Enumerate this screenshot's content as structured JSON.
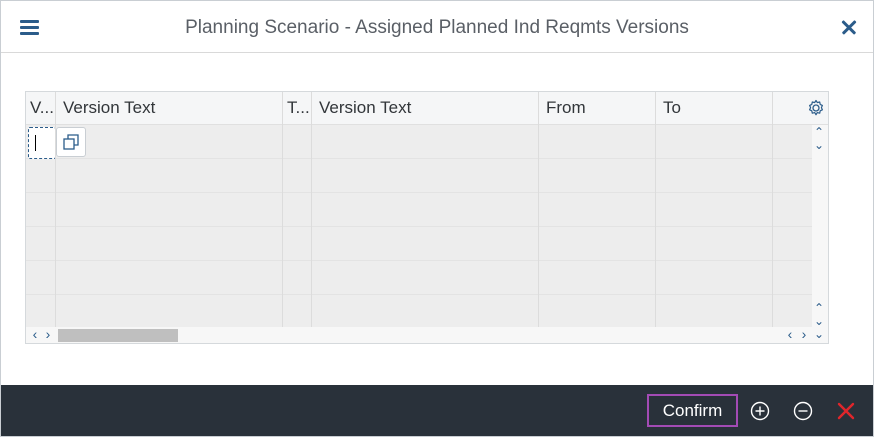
{
  "dialog": {
    "title": "Planning Scenario - Assigned Planned Ind Reqmts Versions"
  },
  "table": {
    "columns": [
      {
        "label": "V..."
      },
      {
        "label": "Version Text"
      },
      {
        "label": "T..."
      },
      {
        "label": "Version Text"
      },
      {
        "label": "From"
      },
      {
        "label": "To"
      }
    ],
    "empty_rows": 6
  },
  "footer": {
    "confirm_label": "Confirm"
  },
  "icons": {
    "menu": "hamburger-icon",
    "close": "close-icon",
    "settings": "gear-icon",
    "copy": "copy-icon",
    "add": "add-circle-icon",
    "remove": "remove-circle-icon",
    "cancel": "cancel-x-icon"
  },
  "colors": {
    "accent": "#2b5c8a",
    "footer_bg": "#29313a",
    "focus_outline": "#a34bb5",
    "cancel_red": "#e0262b"
  }
}
